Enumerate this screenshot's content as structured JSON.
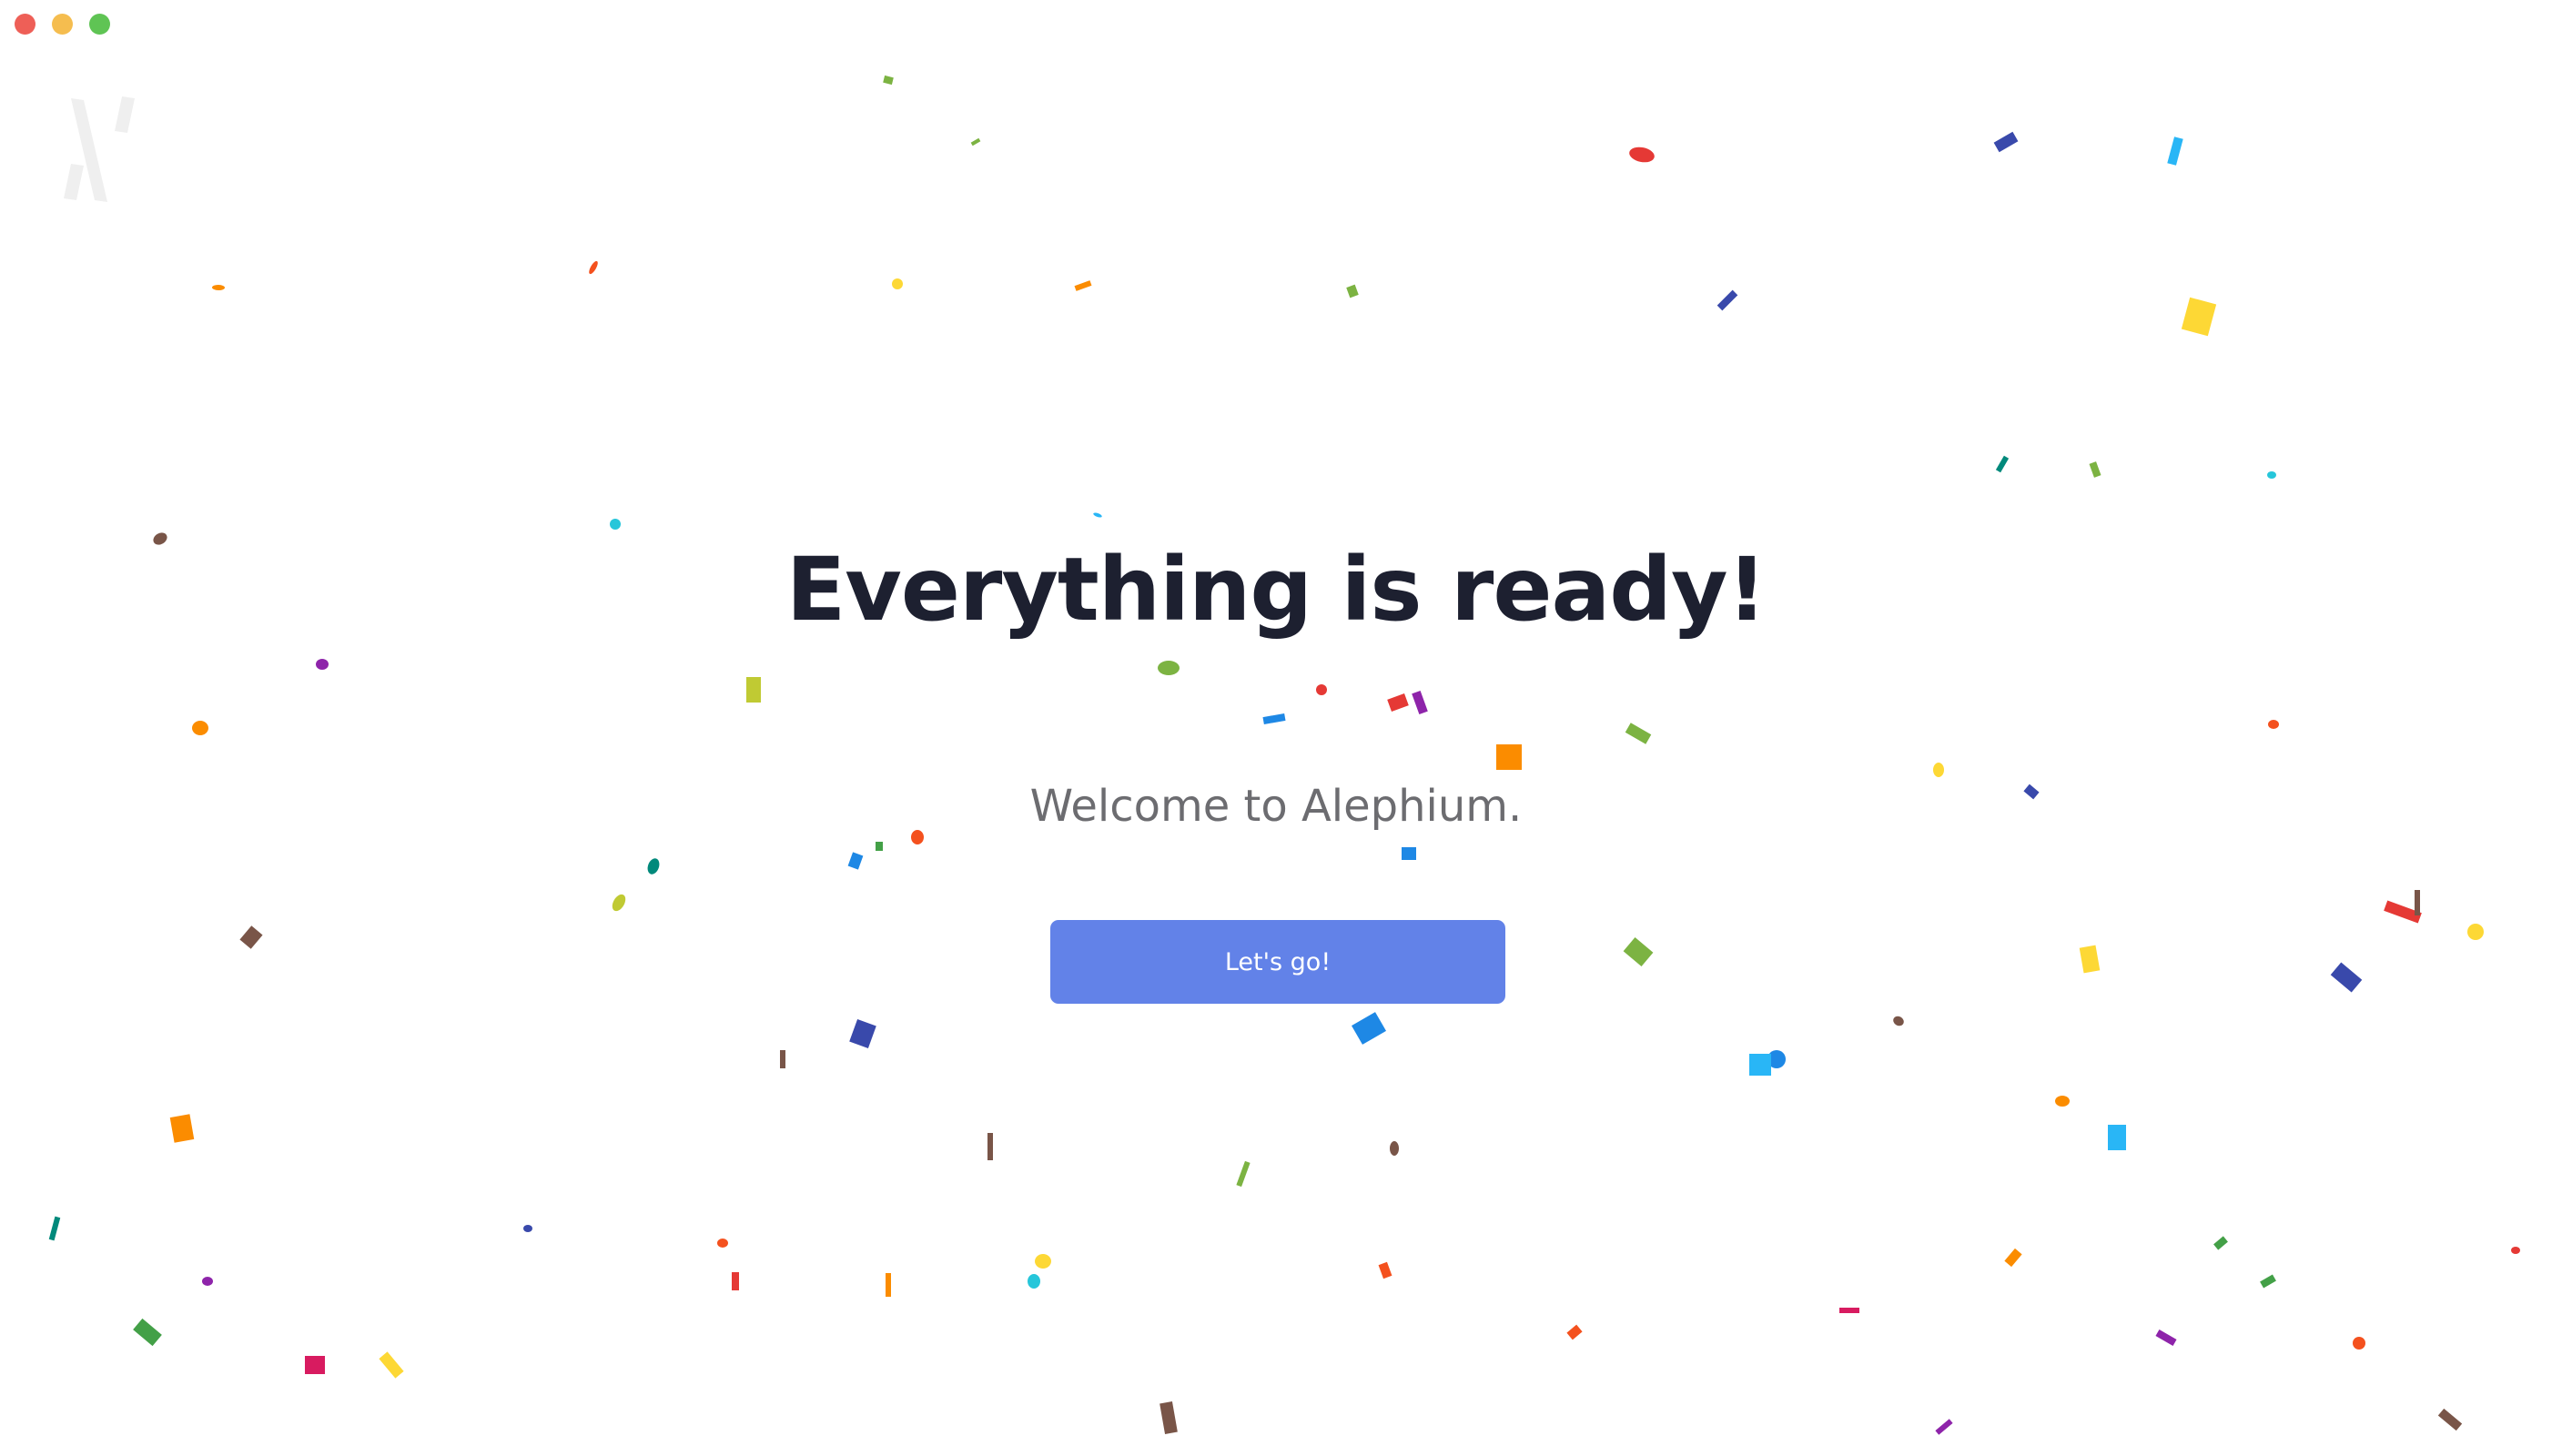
{
  "window": {
    "controls": [
      "close",
      "minimize",
      "maximize"
    ],
    "colors": {
      "close": "#ee5f57",
      "minimize": "#f5bd4f",
      "maximize": "#5fc454"
    }
  },
  "logo": {
    "icon": "alephium-logo-icon"
  },
  "main": {
    "headline": "Everything is ready!",
    "subtitle": "Welcome to Alephium.",
    "cta_label": "Let's go!"
  },
  "colors": {
    "background": "#ffffff",
    "headline": "#1d2030",
    "subtitle": "#6c6c70",
    "button": "#6282e8",
    "button_text": "#ffffff"
  },
  "confetti_palette": [
    "#e53935",
    "#f4511e",
    "#fb8c00",
    "#fdd835",
    "#c0ca33",
    "#7cb342",
    "#43a047",
    "#00897b",
    "#26c6da",
    "#1e88e5",
    "#3949ab",
    "#8e24aa",
    "#d81b60",
    "#795548",
    "#29b6f6"
  ]
}
